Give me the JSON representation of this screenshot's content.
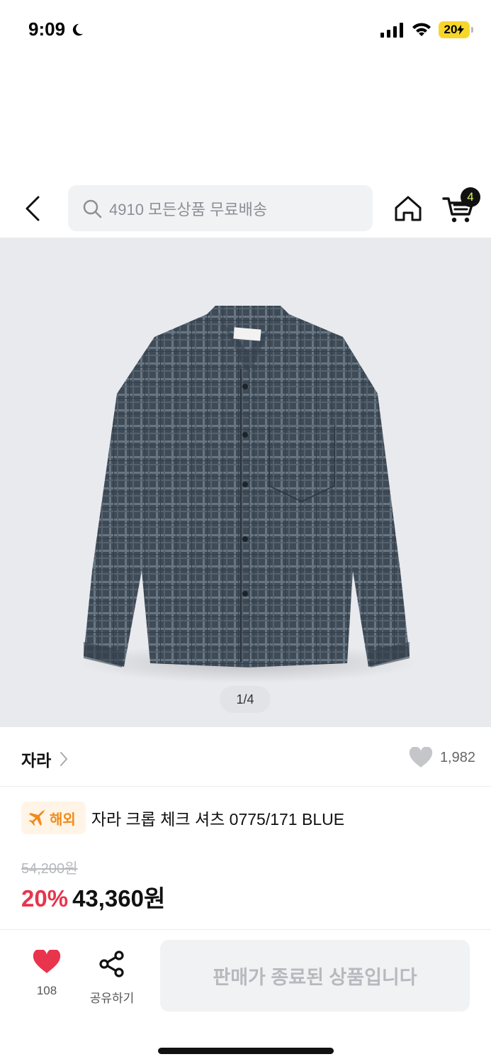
{
  "status_bar": {
    "time": "9:09",
    "battery": "20"
  },
  "header": {
    "search_placeholder": "4910 모든상품 무료배송",
    "cart_count": "4"
  },
  "gallery": {
    "counter": "1/4"
  },
  "product": {
    "brand": "자라",
    "like_count": "1,982",
    "badge": "해외",
    "title": "자라 크롭 체크 셔츠 0775/171 BLUE",
    "original_price": "54,200원",
    "discount": "20%",
    "sale_price": "43,360원"
  },
  "bottom_bar": {
    "wish_count": "108",
    "share_label": "공유하기",
    "soldout_label": "판매가 종료된 상품입니다"
  },
  "colors": {
    "discount": "#e8344d",
    "overseas": "#f18a1c",
    "wish_heart": "#e8344d",
    "cart_badge_text": "#d6f55c"
  },
  "icons": [
    "back-icon",
    "search-icon",
    "home-icon",
    "cart-icon",
    "heart-icon",
    "share-icon",
    "plane-icon",
    "chevron-right-icon"
  ]
}
